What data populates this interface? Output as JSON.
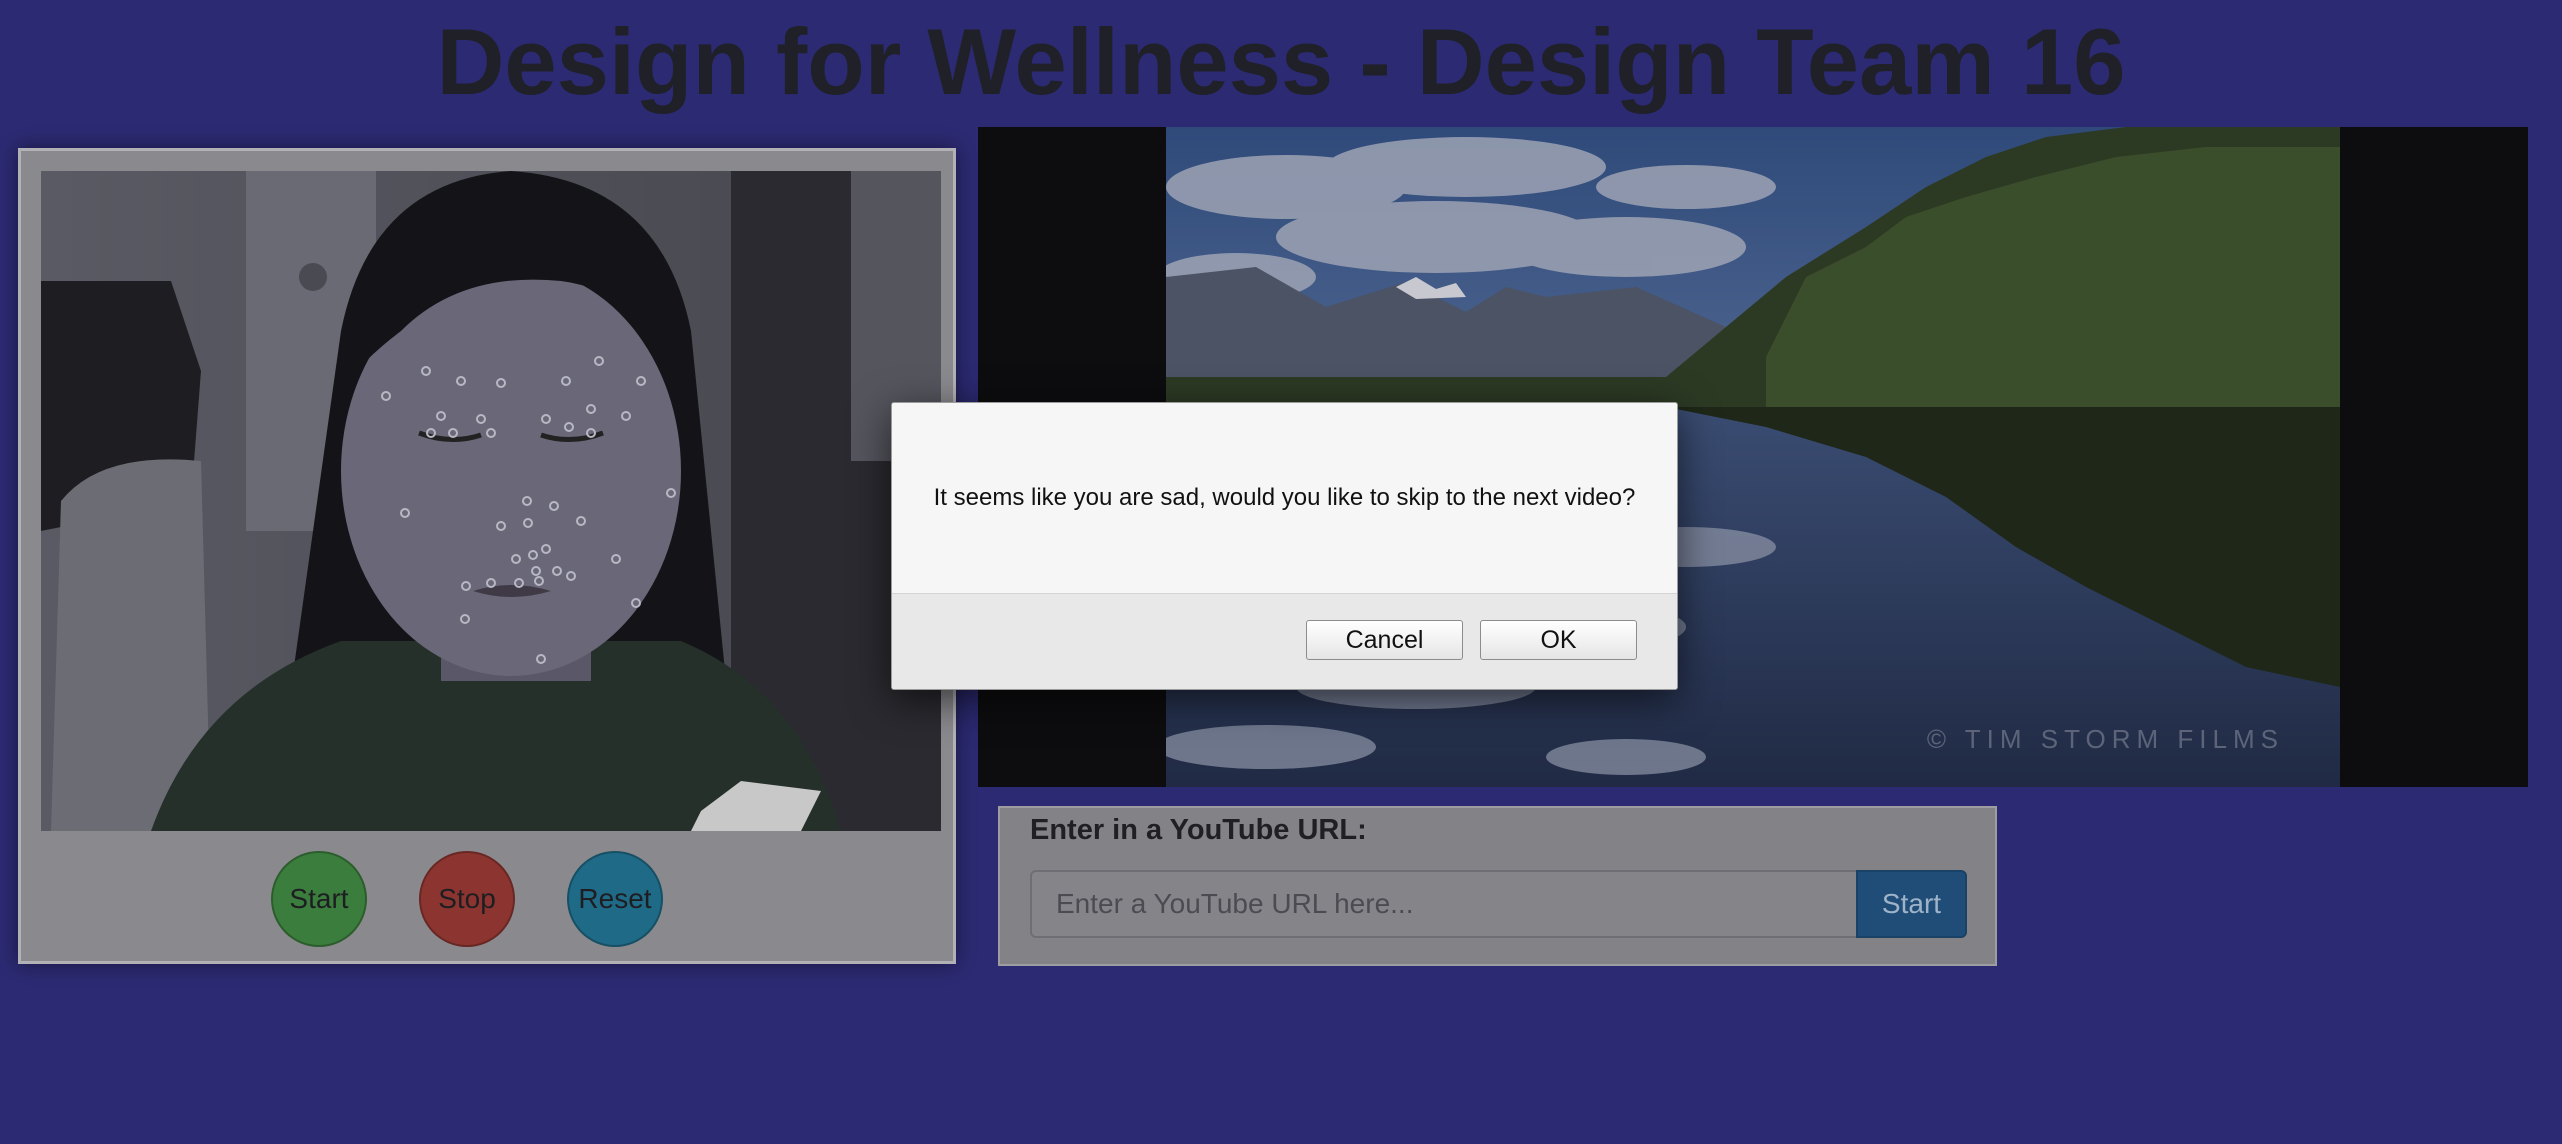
{
  "page": {
    "title": "Design for Wellness - Design Team 16"
  },
  "webcam": {
    "buttons": {
      "start": "Start",
      "stop": "Stop",
      "reset": "Reset"
    },
    "button_colors": {
      "start": "#3b7d3c",
      "stop": "#8c3530",
      "reset": "#1f6a86"
    }
  },
  "video": {
    "watermark": "© TIM STORM FILMS"
  },
  "youtube": {
    "label": "Enter in a YouTube URL:",
    "placeholder": "Enter a YouTube URL here...",
    "start_label": "Start"
  },
  "dialog": {
    "message": "It seems like you are sad, would you like to skip to the next video?",
    "cancel_label": "Cancel",
    "ok_label": "OK"
  },
  "colors": {
    "background": "#2c2a72",
    "start_button": "#1f4d78"
  }
}
